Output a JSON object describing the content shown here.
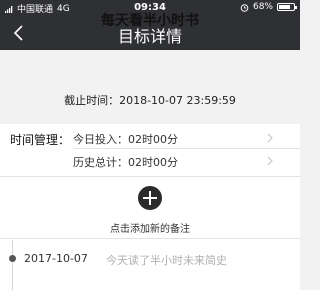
{
  "status_bar": {
    "carrier": "中国联通",
    "network": "4G",
    "time": "09:34",
    "battery": "68%",
    "icons": [
      "signal-icon",
      "alarm-icon",
      "battery-icon"
    ]
  },
  "navbar": {
    "title": "目标详情",
    "back_icon": "chevron-left-icon"
  },
  "goal": {
    "title": "每天看半小时书",
    "deadline": "截止时间：2018-10-07 23:59:59"
  },
  "time_management": {
    "label": "时间管理：",
    "today_invest": "今日投入：02时00分",
    "history_total": "历史总计：02时00分"
  },
  "add_note": {
    "label": "点击添加新的备注",
    "icon": "plus-icon"
  },
  "notes": [
    {
      "date": "2017-10-07",
      "text": "今天读了半小时未来简史"
    }
  ],
  "colors": {
    "header_bg": "#2f3033",
    "page_bg": "#f2f2f2",
    "placeholder_text": "#b0b0b0"
  }
}
